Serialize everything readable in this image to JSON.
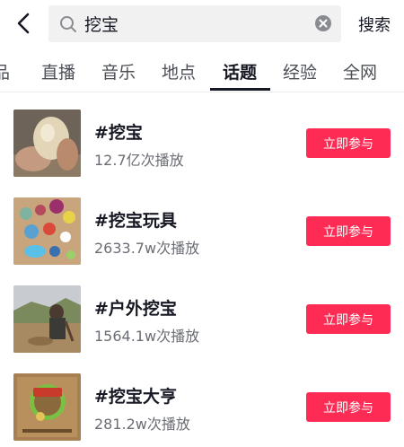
{
  "search": {
    "query": "挖宝",
    "button_label": "搜索"
  },
  "tabs": [
    {
      "label": "品",
      "active": false
    },
    {
      "label": "直播",
      "active": false
    },
    {
      "label": "音乐",
      "active": false
    },
    {
      "label": "地点",
      "active": false
    },
    {
      "label": "话题",
      "active": true
    },
    {
      "label": "经验",
      "active": false
    },
    {
      "label": "全网",
      "active": false
    }
  ],
  "topics": [
    {
      "title": "#挖宝",
      "plays": "12.7亿次播放",
      "button": "立即参与",
      "thumb_icon": "egg-in-hand-photo"
    },
    {
      "title": "#挖宝玩具",
      "plays": "2633.7w次播放",
      "button": "立即参与",
      "thumb_icon": "gem-toys-photo"
    },
    {
      "title": "#户外挖宝",
      "plays": "1564.1w次播放",
      "button": "立即参与",
      "thumb_icon": "outdoor-digging-photo"
    },
    {
      "title": "#挖宝大亨",
      "plays": "281.2w次播放",
      "button": "立即参与",
      "thumb_icon": "game-cover-photo"
    }
  ],
  "colors": {
    "accent": "#fe2c55",
    "text": "#161823",
    "secondary": "#6b6d74",
    "search_bg": "#f1f1f2"
  },
  "icons": {
    "back": "chevron-left-icon",
    "search": "search-icon",
    "clear": "clear-icon"
  }
}
